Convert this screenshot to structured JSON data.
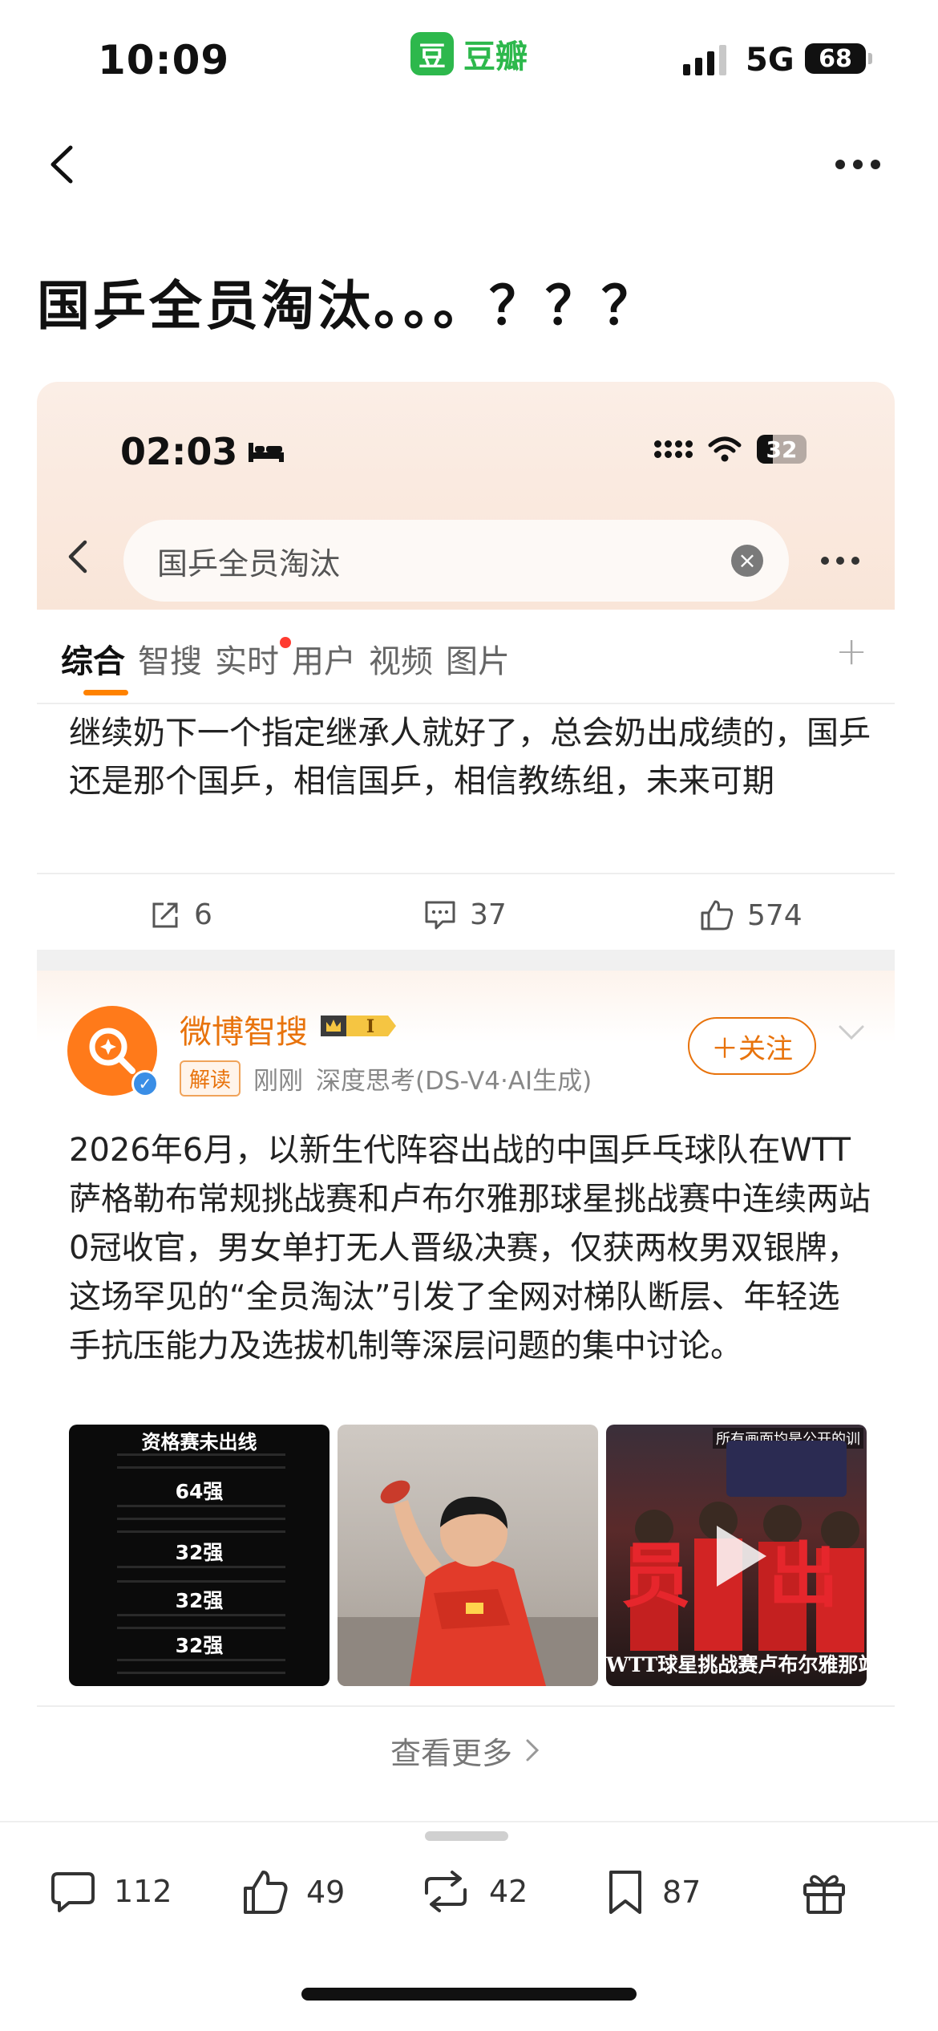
{
  "status_bar": {
    "time": "10:09",
    "app_logo_glyph": "豆",
    "app_name": "豆瓣",
    "network": "5G",
    "battery": "68",
    "signal_bars_active": 3
  },
  "nav": {
    "back_icon": "chevron-left-icon",
    "more_icon": "more-dots-icon"
  },
  "post": {
    "title": "国乒全员淘汰。。。？？？"
  },
  "embedded": {
    "status": {
      "time": "02:03",
      "battery": "32"
    },
    "search": {
      "query": "国乒全员淘汰"
    },
    "tabs": [
      {
        "label": "综合",
        "active": true
      },
      {
        "label": "智搜"
      },
      {
        "label": "实时",
        "dot": true
      },
      {
        "label": "用户"
      },
      {
        "label": "视频"
      },
      {
        "label": "图片"
      }
    ],
    "tab_add_glyph": "+",
    "prev_post": {
      "text": "继续奶下一个指定继承人就好了，总会奶出成绩的，国乒还是那个国乒，相信国乒，相信教练组，未来可期",
      "share_count": "6",
      "comment_count": "37",
      "like_count": "574"
    },
    "card": {
      "author": "微博智搜",
      "level_badge": "I",
      "tag": "解读",
      "time": "刚刚",
      "source": "深度思考(DS-V4·AI生成)",
      "follow_label": "＋关注",
      "text": "2026年6月，以新生代阵容出战的中国乒乓球队在WTT萨格勒布常规挑战赛和卢布尔雅那球星挑战赛中连续两站0冠收官，男女单打无人晋级决赛，仅获两枚男双银牌，这场罕见的“全员淘汰”引发了全网对梯队断层、年轻选手抗压能力及选拔机制等深层问题的集中讨论。",
      "thumb1": {
        "heading": "资格赛未出线",
        "stages": [
          "64强",
          "32强",
          "32强",
          "32强"
        ]
      },
      "thumb3": {
        "top_caption": "所有画面均是公开的训",
        "big_left": "员",
        "big_right": "出",
        "bottom_caption": "WTT球星挑战赛卢布尔雅那站"
      },
      "see_more": "查看更多"
    }
  },
  "bottom_bar": {
    "comments": "112",
    "likes": "49",
    "reposts": "42",
    "collects": "87"
  },
  "colors": {
    "accent": "#ff8200",
    "brand_green": "#2db84c",
    "weibo_orange": "#e8730c"
  }
}
